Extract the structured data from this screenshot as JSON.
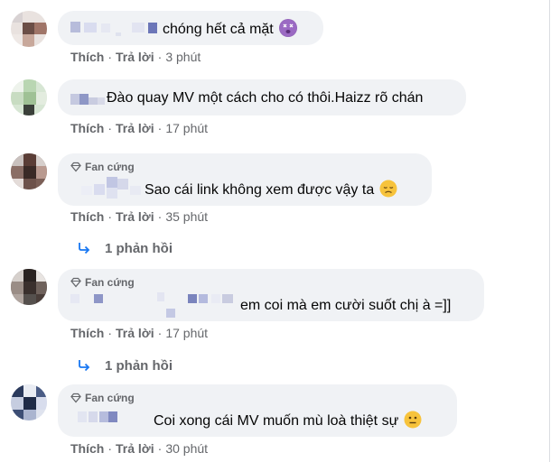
{
  "colors": {
    "link": "#65676b",
    "bubble": "#f0f2f5",
    "text": "#050505",
    "reply_arrow": "#1877f2"
  },
  "comments": [
    {
      "text": "chóng hết cả mặt",
      "emoji": "dizzy-face-emoji",
      "like": "Thích",
      "sep": "·",
      "reply": "Trả lời",
      "time": "3 phút"
    },
    {
      "text": "Đào quay MV một cách cho có thôi.Haizz rõ chán",
      "like": "Thích",
      "sep": "·",
      "reply": "Trả lời",
      "time": "17 phút"
    },
    {
      "badge": "Fan cứng",
      "text": "Sao cái link không xem được vậy ta",
      "emoji": "disappointed-face-emoji",
      "like": "Thích",
      "sep": "·",
      "reply": "Trả lời",
      "time": "35 phút",
      "replies": "1 phản hồi"
    },
    {
      "badge": "Fan cứng",
      "text": "em coi mà em cười suốt chị à =]]",
      "like": "Thích",
      "sep": "·",
      "reply": "Trả lời",
      "time": "17 phút",
      "replies": "1 phản hồi"
    },
    {
      "badge": "Fan cứng",
      "text": "Coi xong cái MV muốn mù loà thiệt sự",
      "emoji": "neutral-face-emoji",
      "like": "Thích",
      "sep": "·",
      "reply": "Trả lời",
      "time": "30 phút"
    }
  ]
}
